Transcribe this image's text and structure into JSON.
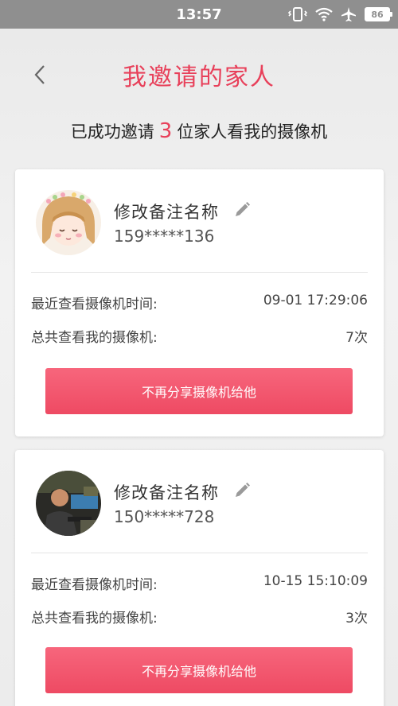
{
  "status_bar": {
    "time": "13:57",
    "battery": "86"
  },
  "header": {
    "title": "我邀请的家人"
  },
  "summary": {
    "prefix": "已成功邀请",
    "count": "3",
    "suffix": "位家人看我的摄像机"
  },
  "contacts": [
    {
      "name": "修改备注名称",
      "phone": "159*****136",
      "last_view_label": "最近查看摄像机时间:",
      "last_view_value": "09-01 17:29:06",
      "total_label": "总共查看我的摄像机:",
      "total_value": "7次",
      "button_label": "不再分享摄像机给他"
    },
    {
      "name": "修改备注名称",
      "phone": "150*****728",
      "last_view_label": "最近查看摄像机时间:",
      "last_view_value": "10-15 15:10:09",
      "total_label": "总共查看我的摄像机:",
      "total_value": "3次",
      "button_label": "不再分享摄像机给他"
    }
  ],
  "colors": {
    "accent": "#e8405a",
    "button": "#ee4a63",
    "status_bar": "#8f8f8f"
  }
}
